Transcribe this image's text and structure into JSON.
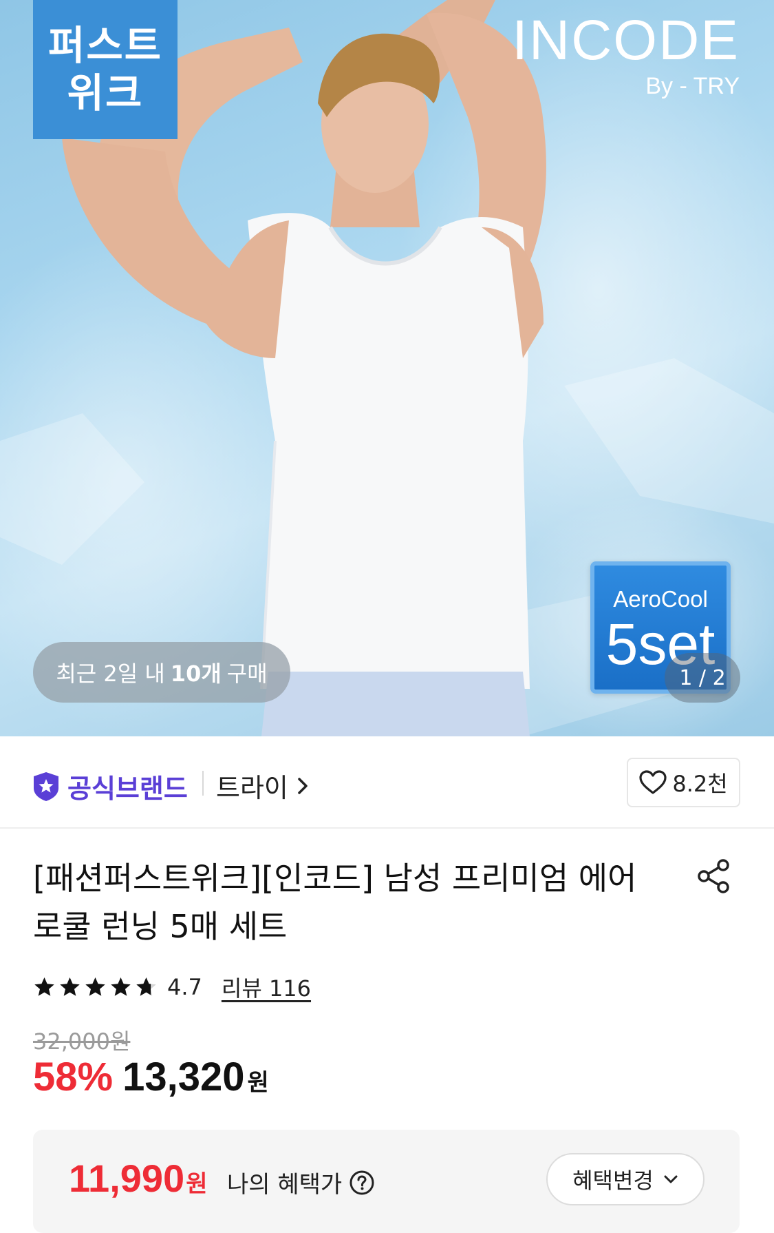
{
  "hero": {
    "promo_badge": [
      "퍼스트",
      "위크"
    ],
    "brand_logo": {
      "main": "INCODE",
      "sub": "By - TRY"
    },
    "set_badge": {
      "label": "AeroCool",
      "count": "5set"
    },
    "recent_purchase": {
      "prefix": "최근 2일 내",
      "count": "10개",
      "suffix": "구매"
    },
    "page_indicator": "1 / 2",
    "colors": {
      "sky": "#a9d6ef",
      "badge_blue": "#3b8fd6",
      "set_blue": "#1f7ad4"
    }
  },
  "brand_row": {
    "official_label": "공식브랜드",
    "official_icon": "star-shield-icon",
    "store_name": "트라이",
    "like_count": "8.2천"
  },
  "product": {
    "title_line1": "[패션퍼스트위크][인코드] 남성 프리미엄 에어",
    "title_line2": "로쿨 런닝 5매 세트",
    "rating": "4.7",
    "stars_filled": 4.7,
    "review_link": "리뷰 116",
    "original_price": "32,000원",
    "discount_rate": "58%",
    "sale_price": "13,320",
    "sale_unit": "원"
  },
  "benefit": {
    "amount": "11,990",
    "unit": "원",
    "label": "나의 혜택가",
    "change_button": "혜택변경"
  },
  "colors": {
    "accent_red": "#ee2c36",
    "official_purple": "#5a3fd6"
  }
}
